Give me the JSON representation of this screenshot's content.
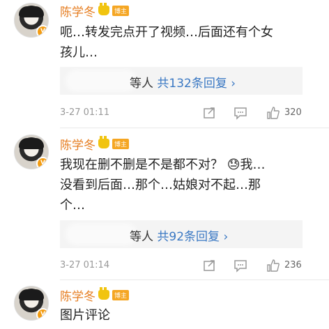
{
  "comments": [
    {
      "author": "陈学冬",
      "badge": "博主",
      "text_line1": "呃…转发完点开了视频…后面还有个女",
      "text_line2": "孩儿…",
      "reply_suffix": "等人",
      "reply_count": "共132条回复",
      "reply_arrow": "›",
      "time": "3-27 01:11",
      "likes": "320"
    },
    {
      "author": "陈学冬",
      "badge": "博主",
      "text_line1": "我现在删不删是不是都不对？ 😓我…",
      "text_line2": "没看到后面…那个…姑娘对不起…那",
      "text_line3": "个…",
      "reply_suffix": "等人",
      "reply_count": "共92条回复",
      "reply_arrow": "›",
      "time": "3-27 01:14",
      "likes": "236"
    },
    {
      "author": "陈学冬",
      "badge": "博主",
      "text_line1": "图片评论"
    }
  ],
  "colors": {
    "name": "#e67e22",
    "link": "#3a78c3",
    "meta": "#999999"
  },
  "icons": [
    "repost-icon",
    "comment-icon",
    "like-icon",
    "verified-badge-icon",
    "crown-icon"
  ]
}
